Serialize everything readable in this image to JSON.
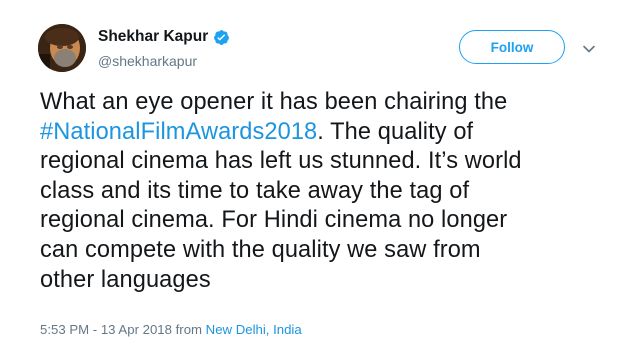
{
  "user": {
    "display_name": "Shekhar Kapur",
    "handle": "@shekharkapur",
    "verified_icon": "verified-badge-icon",
    "avatar_icon": "profile-photo"
  },
  "actions": {
    "follow_label": "Follow",
    "menu_icon": "chevron-down-icon"
  },
  "tweet": {
    "line1": "What an eye opener it has been chairing the",
    "hashtag": "#NationalFilmAwards2018",
    "line2_rest": ". The quality of",
    "line3": "regional cinema has left us stunned. It’s world",
    "line4": "class and its time to take away the tag of",
    "line5": "regional cinema. For Hindi cinema no longer",
    "line6": "can compete with the quality we saw from",
    "line7": "other languages"
  },
  "meta": {
    "timestamp": "5:53 PM - 13 Apr 2018",
    "from_label": " from ",
    "location": "New Delhi, India"
  },
  "colors": {
    "accent": "#1da1f2",
    "link": "#1b95e0",
    "secondary_text": "#657786"
  }
}
